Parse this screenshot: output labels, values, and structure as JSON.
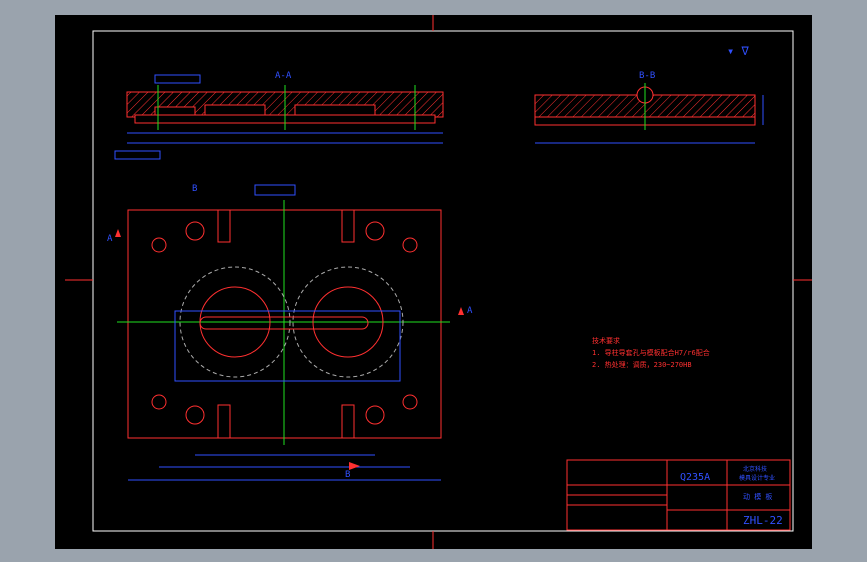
{
  "section_views": {
    "aa_label": "A-A",
    "bb_label": "B-B"
  },
  "material": "Q235A",
  "drawing_number": "ZHL-22",
  "part_name": "动 模 板",
  "company_line1": "北京科技",
  "company_line2": "模具设计专业",
  "notes_title": "技术要求",
  "notes": [
    "1. 导柱导套孔与模板配合H7/r6配合",
    "2. 热处理：调质，230~270HB"
  ],
  "cut_markers": {
    "a": "A",
    "b": "B"
  },
  "colors": {
    "background": "#000000",
    "outline": "#ff2020",
    "dimension": "#3050ff",
    "centerline": "#20e020",
    "hatch": "#ff3030",
    "text": "#ff3030",
    "frame": "#ffffff"
  }
}
